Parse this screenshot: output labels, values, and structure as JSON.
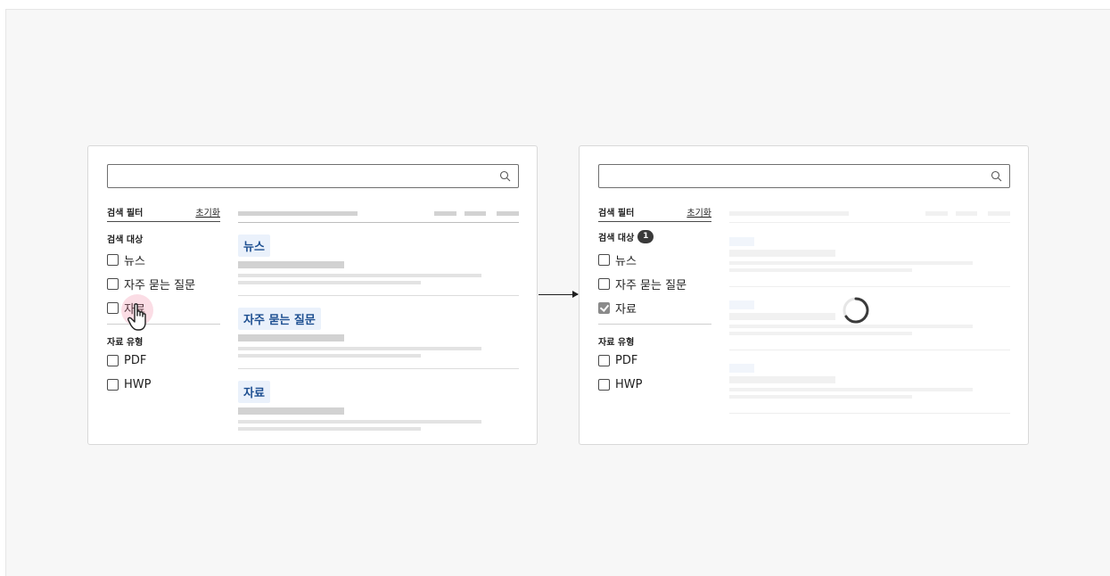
{
  "before": {
    "filter_title": "검색 필터",
    "reset_label": "초기화",
    "target_group_label": "검색 대상",
    "target_options": [
      {
        "label": "뉴스",
        "checked": false
      },
      {
        "label": "자주 묻는 질문",
        "checked": false
      },
      {
        "label": "자료",
        "checked": false
      }
    ],
    "type_group_label": "자료 유형",
    "type_options": [
      {
        "label": "PDF",
        "checked": false
      },
      {
        "label": "HWP",
        "checked": false
      }
    ],
    "result_categories": [
      "뉴스",
      "자주 묻는 질문",
      "자료"
    ]
  },
  "after": {
    "filter_title": "검색 필터",
    "reset_label": "초기화",
    "target_group_label": "검색 대상",
    "target_badge": "1",
    "target_options": [
      {
        "label": "뉴스",
        "checked": false
      },
      {
        "label": "자주 묻는 질문",
        "checked": false
      },
      {
        "label": "자료",
        "checked": true
      }
    ],
    "type_group_label": "자료 유형",
    "type_options": [
      {
        "label": "PDF",
        "checked": false
      },
      {
        "label": "HWP",
        "checked": false
      }
    ],
    "loading": true
  },
  "colors": {
    "accent_chip_bg": "#eaf1fb",
    "accent_chip_text": "#1d4f91",
    "pointer_halo": "#f078964d",
    "checked_box": "#8a8a8a"
  },
  "icons": [
    "search-icon",
    "hand-pointer-icon",
    "arrow-right-icon",
    "loading-spinner-icon"
  ]
}
